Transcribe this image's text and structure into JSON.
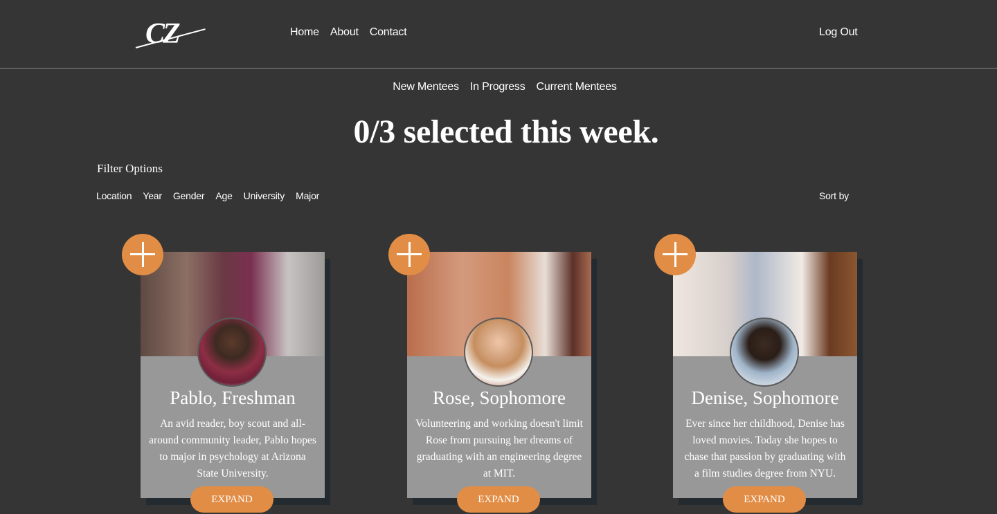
{
  "header": {
    "logo_text": "CZ",
    "nav": [
      "Home",
      "About",
      "Contact"
    ],
    "logout": "Log Out"
  },
  "subnav": [
    "New Mentees",
    "In Progress",
    "Current Mentees"
  ],
  "headline": "0/3 selected this week.",
  "filters": {
    "title": "Filter Options",
    "options": [
      "Location",
      "Year",
      "Gender",
      "Age",
      "University",
      "Major"
    ],
    "sort_label": "Sort by"
  },
  "mentees": [
    {
      "name": "Pablo, Freshman",
      "description": "An avid reader, boy scout and all-around community leader, Pablo hopes to major in psychology at Arizona State University.",
      "expand_label": "EXPAND"
    },
    {
      "name": "Rose, Sophomore",
      "description": "Volunteering and working doesn't limit Rose from pursuing her dreams of graduating with an engineering degree at MIT.",
      "expand_label": "EXPAND"
    },
    {
      "name": "Denise, Sophomore",
      "description": "Ever since her childhood, Denise has loved movies. Today she hopes to chase that passion by graduating with a film studies degree from NYU.",
      "expand_label": "EXPAND"
    }
  ],
  "colors": {
    "background": "#353535",
    "accent": "#e28d45",
    "card": "#989898"
  }
}
